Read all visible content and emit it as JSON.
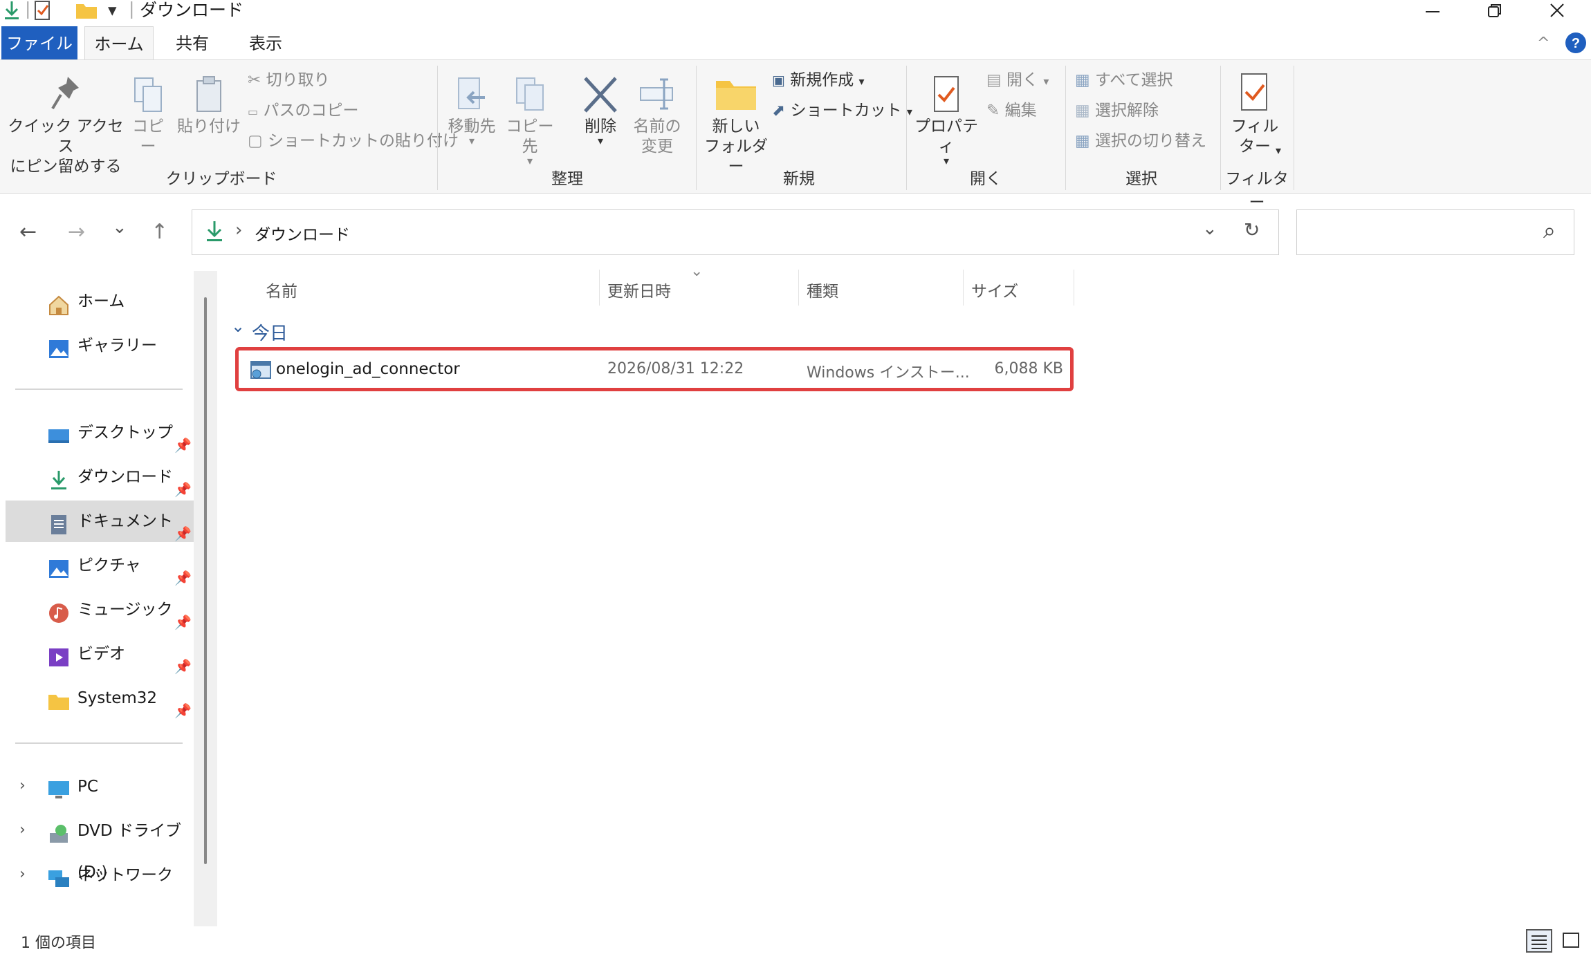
{
  "titlebar": {
    "title": "ダウンロード",
    "minimize_icon": "minimize-icon",
    "maximize_icon": "restore-icon",
    "close_icon": "close-icon",
    "qa_separator": "|",
    "qa_dropdown": "▾"
  },
  "tabs": [
    "ファイル",
    "ホーム",
    "共有",
    "表示"
  ],
  "ribbon": {
    "clipboard": {
      "pin_label": "クイック アクセス\nにピン留めする",
      "copy": "コピー",
      "paste": "貼り付け",
      "cut": "切り取り",
      "copy_path": "パスのコピー",
      "paste_shortcut": "ショートカットの貼り付け",
      "group": "クリップボード"
    },
    "organize": {
      "move_to": "移動先",
      "copy_to": "コピー先",
      "delete": "削除",
      "rename": "名前の\n変更",
      "group": "整理"
    },
    "new": {
      "new_folder": "新しい\nフォルダー",
      "new_item": "新規作成",
      "shortcut": "ショートカット",
      "group": "新規"
    },
    "open": {
      "properties": "プロパティ",
      "open": "開く",
      "edit": "編集",
      "group": "開く"
    },
    "select": {
      "select_all": "すべて選択",
      "select_none": "選択解除",
      "invert": "選択の切り替え",
      "group": "選択"
    },
    "filter": {
      "filter": "フィル\nター",
      "group": "フィルター"
    },
    "dropdown_glyph": "▾"
  },
  "address": {
    "path": "ダウンロード",
    "separator": "›",
    "nav_back": "←",
    "nav_forward": "→",
    "nav_recent": "⌄",
    "nav_up": "↑",
    "dropdown": "⌄",
    "refresh": "↻",
    "search_icon": "⌕"
  },
  "sidebar": {
    "items": [
      {
        "label": "ホーム",
        "icon": "home-icon"
      },
      {
        "label": "ギャラリー",
        "icon": "gallery-icon"
      },
      {
        "label": "デスクトップ",
        "icon": "desktop-icon",
        "pinned": true
      },
      {
        "label": "ダウンロード",
        "icon": "download-icon",
        "pinned": true
      },
      {
        "label": "ドキュメント",
        "icon": "document-icon",
        "pinned": true,
        "selected": true
      },
      {
        "label": "ピクチャ",
        "icon": "pictures-icon",
        "pinned": true
      },
      {
        "label": "ミュージック",
        "icon": "music-icon",
        "pinned": true
      },
      {
        "label": "ビデオ",
        "icon": "video-icon",
        "pinned": true
      },
      {
        "label": "System32",
        "icon": "folder-icon",
        "pinned": true
      },
      {
        "label": "PC",
        "icon": "pc-icon"
      },
      {
        "label": "DVD ドライブ (D:)",
        "icon": "dvd-icon"
      },
      {
        "label": "ネットワーク",
        "icon": "network-icon"
      }
    ],
    "expand_glyph": "›"
  },
  "content": {
    "columns": [
      "名前",
      "更新日時",
      "種類",
      "サイズ"
    ],
    "sort_glyph": "⌄",
    "group": "今日",
    "group_glyph": "⌄",
    "files": [
      {
        "name": "onelogin_ad_connector",
        "date": "2026/08/31 12:22",
        "type": "Windows インストー...",
        "size": "6,088 KB"
      }
    ],
    "highlight_color": "#e04040"
  },
  "status": {
    "count": "1 個の項目"
  }
}
